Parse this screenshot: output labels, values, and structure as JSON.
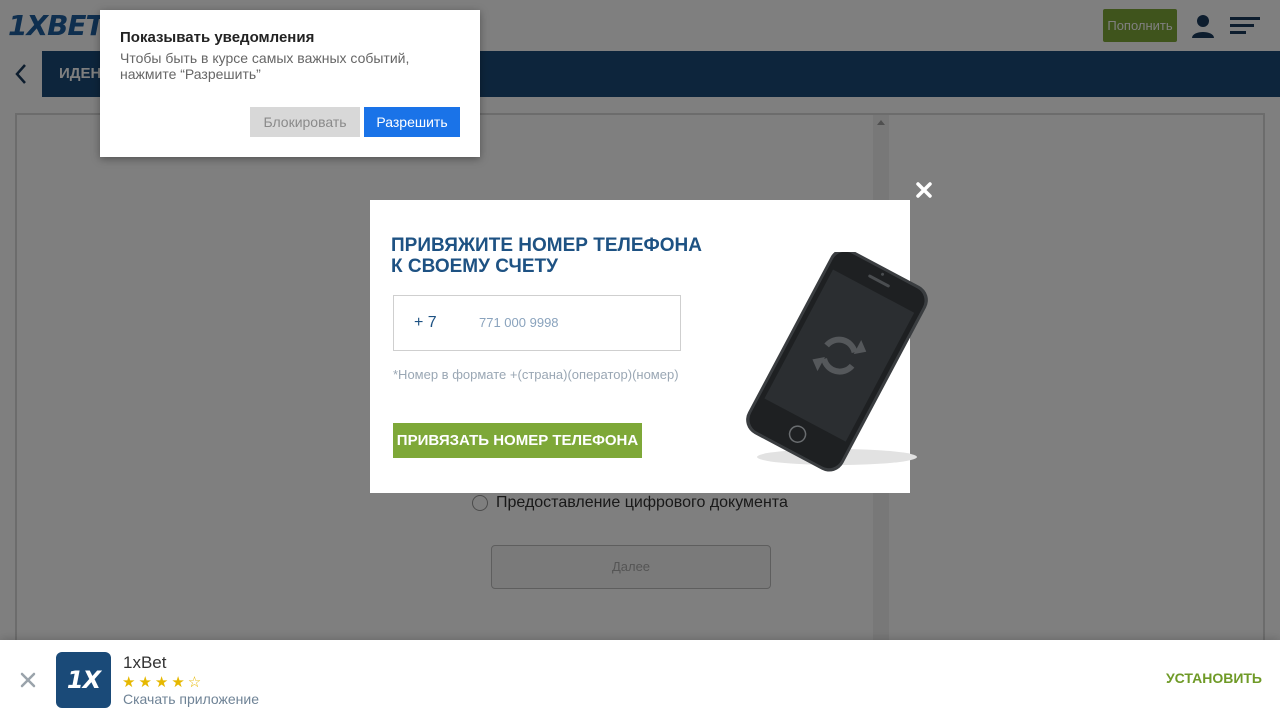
{
  "header": {
    "logo_text": "1XBET",
    "deposit_label": "Пополнить",
    "user_icon": "user-icon",
    "menu_icon": "menu-icon"
  },
  "nav": {
    "back_icon": "chevron-left-icon",
    "title": "ИДЕНТ"
  },
  "content": {
    "radio_label": "Предоставление цифрового документа",
    "next_label": "Далее"
  },
  "notification": {
    "title": "Показывать уведомления",
    "text": "Чтобы быть в курсе самых важных событий, нажмите “Разрешить”",
    "block_label": "Блокировать",
    "allow_label": "Разрешить"
  },
  "phone_modal": {
    "title": "ПРИВЯЖИТЕ НОМЕР ТЕЛЕФОНА К СВОЕМУ СЧЕТУ",
    "country_code": "+ 7",
    "phone_placeholder": "771 000 9998",
    "hint": "*Номер в формате +(страна)(оператор)(номер)",
    "bind_label": "ПРИВЯЗАТЬ НОМЕР ТЕЛЕФОНА",
    "close_icon": "close-icon"
  },
  "app_banner": {
    "icon_text": "1X",
    "name": "1xBet",
    "rating": 4.5,
    "stars": "★★★★☆",
    "subtitle": "Скачать приложение",
    "install_label": "УСТАНОВИТЬ"
  },
  "colors": {
    "brand_blue": "#1a4a78",
    "accent_green": "#7ea838",
    "allow_blue": "#1a73e8"
  }
}
